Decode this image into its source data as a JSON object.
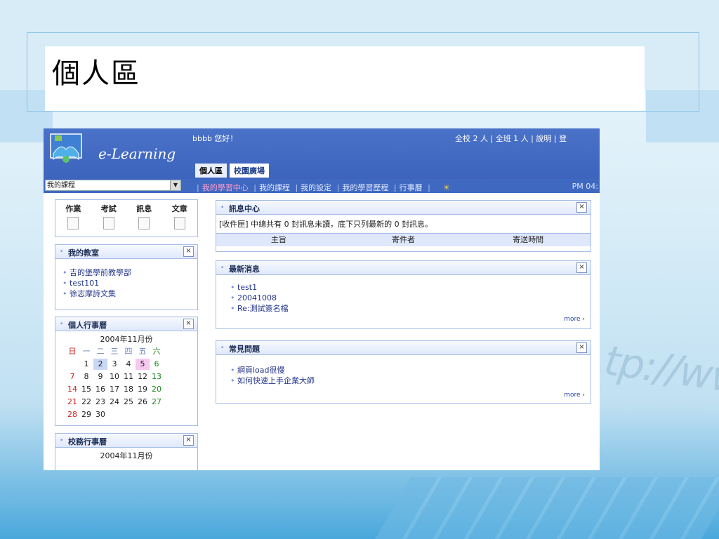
{
  "slide": {
    "title": "個人區"
  },
  "background": {
    "url_text": "tp://www"
  },
  "app": {
    "logo_text": "e-Learning",
    "greeting": "bbbb 您好！",
    "top_links": "全校 2 人 | 全班 1 人 | 說明 | 登",
    "tabs": [
      {
        "label": "個人區"
      },
      {
        "label": "校園廣場"
      }
    ],
    "course_select": "我的課程",
    "nav": [
      {
        "label": "我的學習中心"
      },
      {
        "label": "我的課程"
      },
      {
        "label": "我的設定"
      },
      {
        "label": "我的學習歷程"
      },
      {
        "label": "行事曆"
      }
    ],
    "clock": "PM 04:"
  },
  "tools": [
    {
      "label": "作業"
    },
    {
      "label": "考試"
    },
    {
      "label": "訊息"
    },
    {
      "label": "文章"
    }
  ],
  "my_classroom": {
    "title": "我的教室",
    "items": [
      "吉的堡學前教學部",
      "test101",
      "徐志摩詩文集"
    ]
  },
  "personal_calendar": {
    "title": "個人行事曆",
    "month": "2004年11月份",
    "weekdays": [
      "日",
      "一",
      "二",
      "三",
      "四",
      "五",
      "六"
    ],
    "weeks": [
      [
        "",
        "1",
        "2",
        "3",
        "4",
        "5",
        "6"
      ],
      [
        "7",
        "8",
        "9",
        "10",
        "11",
        "12",
        "13"
      ],
      [
        "14",
        "15",
        "16",
        "17",
        "18",
        "19",
        "20"
      ],
      [
        "21",
        "22",
        "23",
        "24",
        "25",
        "26",
        "27"
      ],
      [
        "28",
        "29",
        "30",
        "",
        "",
        "",
        ""
      ]
    ]
  },
  "school_calendar": {
    "title": "校務行事曆",
    "month": "2004年11月份"
  },
  "message_center": {
    "title": "訊息中心",
    "summary": "[收件匣] 中總共有 0 封訊息未讀，底下只列最新的 0 封訊息。",
    "columns": [
      "主旨",
      "寄件者",
      "寄送時間"
    ]
  },
  "news": {
    "title": "最新消息",
    "items": [
      "test1",
      "20041008",
      "Re:測試簽名檔"
    ],
    "more": "more"
  },
  "faq": {
    "title": "常見問題",
    "items": [
      "網頁load很慢",
      "如何快速上手企業大師"
    ],
    "more": "more"
  },
  "colors": {
    "header_blue": "#3d64bd",
    "link_blue": "#23358a",
    "accent_pink": "#ff9fd0"
  }
}
